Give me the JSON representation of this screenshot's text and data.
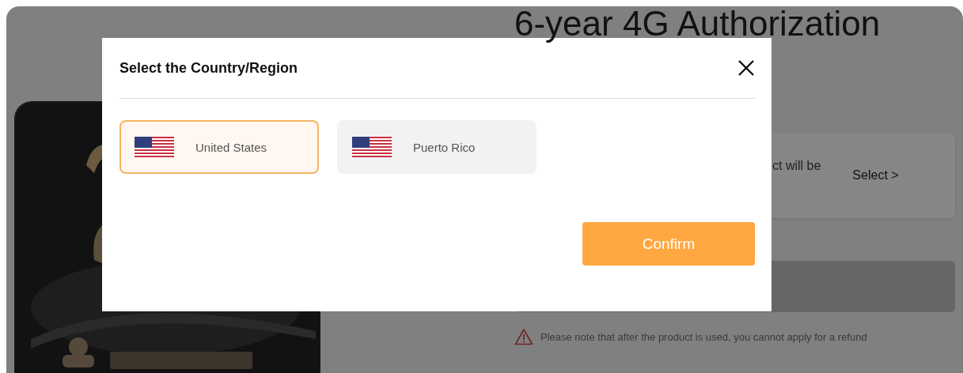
{
  "page": {
    "title": "6-year 4G Authorization",
    "option": {
      "text": "ct will be",
      "action": "Select >"
    },
    "notice": "Please note that after the product is used, you cannot apply for a refund"
  },
  "dialog": {
    "title": "Select the Country/Region",
    "countries": [
      {
        "name": "United States",
        "selected": true
      },
      {
        "name": "Puerto Rico",
        "selected": false
      }
    ],
    "confirm": "Confirm"
  }
}
